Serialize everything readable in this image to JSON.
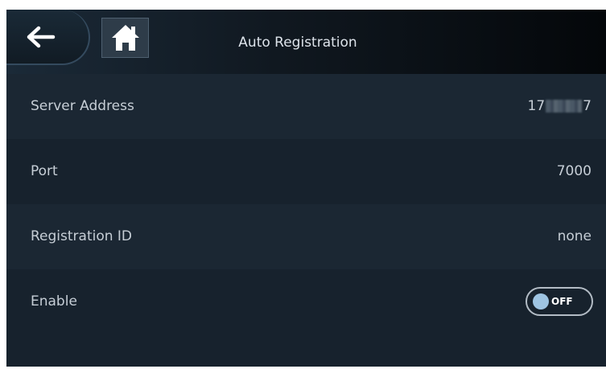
{
  "header": {
    "title": "Auto Registration",
    "back_icon": "arrow-left-icon",
    "home_icon": "home-icon"
  },
  "settings": [
    {
      "label": "Server Address",
      "value_prefix": "17",
      "value_suffix": "7",
      "value_masked": true
    },
    {
      "label": "Port",
      "value": "7000"
    },
    {
      "label": "Registration ID",
      "value": "none"
    },
    {
      "label": "Enable",
      "toggle_state": "OFF",
      "enabled": false
    }
  ],
  "colors": {
    "background": "#17222d",
    "row_alt": "#1b2733",
    "text": "#c6ced6",
    "toggle_knob": "#9ec4e2"
  }
}
